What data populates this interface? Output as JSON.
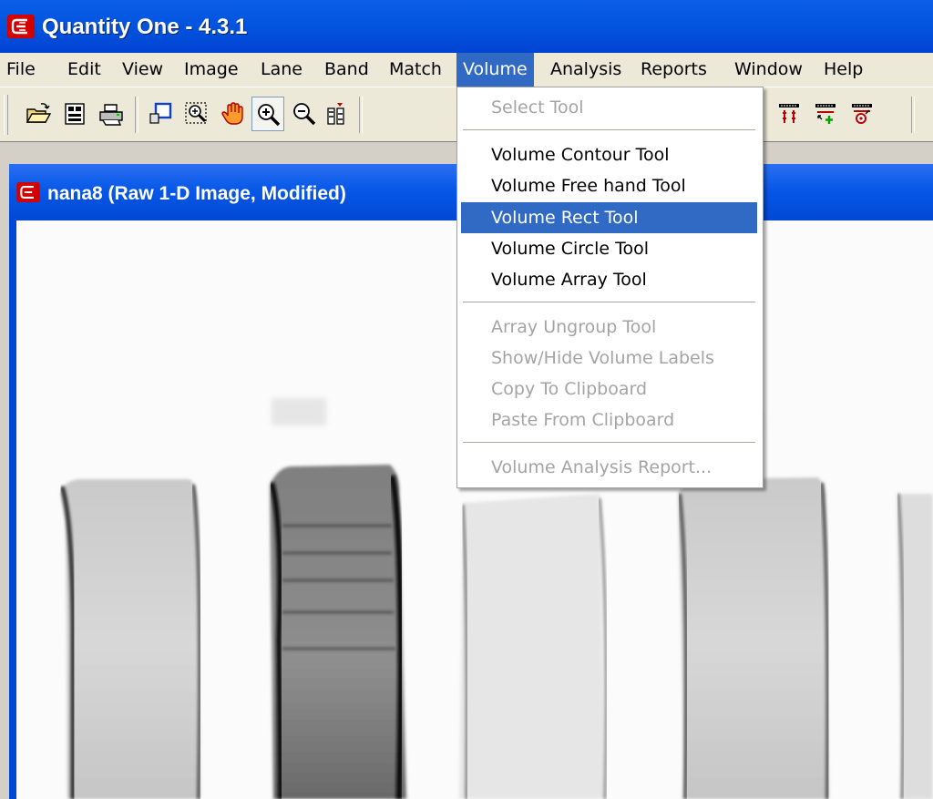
{
  "app": {
    "title": "Quantity One - 4.3.1"
  },
  "menubar": {
    "items": [
      {
        "label": "File"
      },
      {
        "label": "Edit"
      },
      {
        "label": "View"
      },
      {
        "label": "Image"
      },
      {
        "label": "Lane"
      },
      {
        "label": "Band"
      },
      {
        "label": "Match"
      },
      {
        "label": "Volume"
      },
      {
        "label": "Analysis"
      },
      {
        "label": "Reports"
      },
      {
        "label": "Window"
      },
      {
        "label": "Help"
      }
    ],
    "active": "Volume"
  },
  "toolbar": {
    "buttons": [
      {
        "icon": "open-folder-icon"
      },
      {
        "icon": "properties-icon"
      },
      {
        "icon": "print-icon"
      },
      {
        "icon": "select-region-icon"
      },
      {
        "icon": "zoom-box-icon"
      },
      {
        "icon": "grab-hand-icon"
      },
      {
        "icon": "zoom-in-icon",
        "pressed": true
      },
      {
        "icon": "zoom-out-icon"
      },
      {
        "icon": "lane-profile-icon"
      },
      {
        "icon": "band-tool-icon"
      },
      {
        "icon": "match-bands-icon"
      },
      {
        "icon": "add-band-icon"
      },
      {
        "icon": "band-attributes-icon"
      }
    ]
  },
  "document": {
    "title": "nana8 (Raw 1-D Image, Modified)"
  },
  "volume_menu": {
    "items": [
      {
        "label": "Select Tool",
        "enabled": false
      },
      {
        "label": "Volume Contour Tool",
        "enabled": true
      },
      {
        "label": "Volume Free hand Tool",
        "enabled": true
      },
      {
        "label": "Volume Rect Tool",
        "enabled": true,
        "highlighted": true
      },
      {
        "label": "Volume Circle Tool",
        "enabled": true
      },
      {
        "label": "Volume Array Tool",
        "enabled": true
      },
      {
        "label": "Array Ungroup Tool",
        "enabled": false
      },
      {
        "label": "Show/Hide Volume Labels",
        "enabled": false
      },
      {
        "label": "Copy To Clipboard",
        "enabled": false
      },
      {
        "label": "Paste From Clipboard",
        "enabled": false
      },
      {
        "label": "Volume Analysis Report...",
        "enabled": false
      }
    ]
  },
  "colors": {
    "titlebar": "#0456e0",
    "menu_highlight": "#316ac5",
    "disabled_text": "#a4a4a4",
    "app_icon": "#d40000"
  }
}
